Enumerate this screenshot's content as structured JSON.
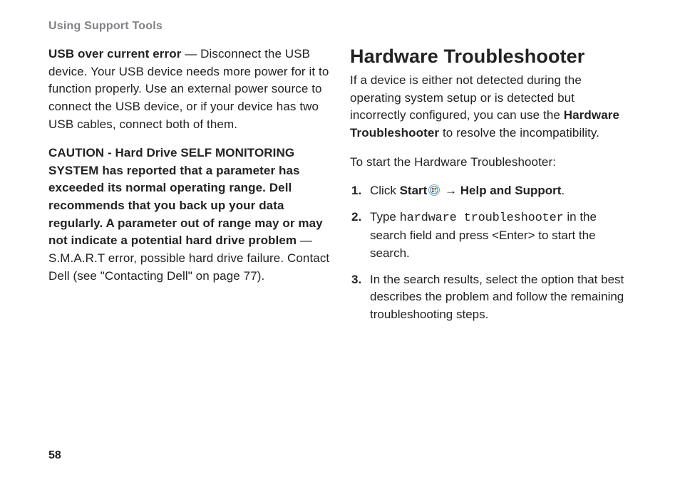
{
  "header": {
    "title": "Using Support Tools"
  },
  "left": {
    "usb": {
      "label": "USB over current error",
      "text": " — Disconnect the USB device. Your USB device needs more power for it to function properly. Use an external power source to connect the USB device, or if your device has two USB cables, connect both of them."
    },
    "caution": {
      "label": "CAUTION - Hard Drive SELF MONITORING SYSTEM has reported that a parameter has exceeded its normal operating range. Dell recommends that you back up your data regularly. A parameter out of range may or may not indicate a potential hard drive problem",
      "text": " — S.M.A.R.T error, possible hard drive failure. Contact Dell (see \"Contacting Dell\" on page 77)."
    }
  },
  "right": {
    "heading": "Hardware Troubleshooter",
    "intro_pre": "If a device is either not detected during the operating system setup or is detected but incorrectly configured, you can use the ",
    "intro_bold": "Hardware Troubleshooter",
    "intro_post": " to resolve the incompatibility.",
    "start": "To start the Hardware Troubleshooter:",
    "step1": {
      "num": "1.",
      "pre": "Click ",
      "b1": "Start",
      "mid": " → ",
      "b2": "Help and Support",
      "post": "."
    },
    "step2": {
      "num": "2.",
      "pre": "Type ",
      "code": "hardware troubleshooter",
      "post": " in the search field and press <Enter> to start the search."
    },
    "step3": {
      "num": "3.",
      "text": "In the search results, select the option that best describes the problem and follow the remaining troubleshooting steps."
    }
  },
  "page_number": "58"
}
